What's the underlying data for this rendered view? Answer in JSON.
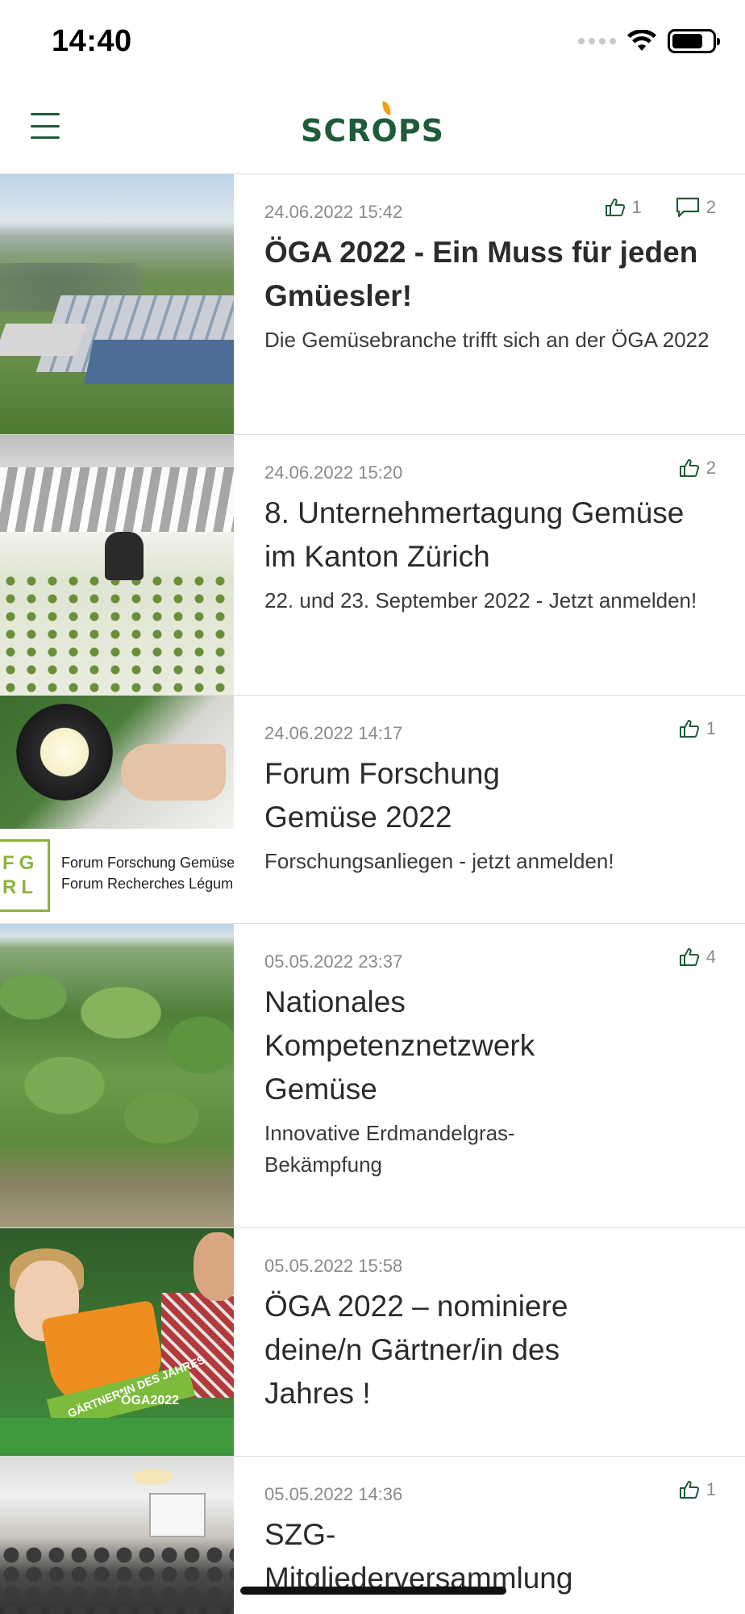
{
  "status_bar": {
    "time": "14:40"
  },
  "header": {
    "logo_text": "SCR",
    "logo_o": "O",
    "logo_end": "PS",
    "brand_color": "#1f5b3a",
    "accent_color": "#f3a012"
  },
  "articles": [
    {
      "date": "24.06.2022 15:42",
      "likes": "1",
      "comments": "2",
      "title": "ÖGA 2022 - Ein Muss für jeden Gmüesler!",
      "subtitle": "Die Gemüsebranche trifft sich an der ÖGA 2022",
      "title_bold": true
    },
    {
      "date": "24.06.2022 15:20",
      "likes": "2",
      "title": "8. Unternehmertagung Gemüse im Kanton Zürich",
      "subtitle": "22. und 23. September 2022 - Jetzt anmelden!"
    },
    {
      "date": "24.06.2022 14:17",
      "likes": "1",
      "title": "Forum Forschung Gemüse 2022",
      "subtitle": "Forschungsanliegen - jetzt anmelden!",
      "thumb_logo": "FG\nRL",
      "thumb_line1": "Forum Forschung Gemüse",
      "thumb_line2": "Forum Recherches Légum"
    },
    {
      "date": "05.05.2022 23:37",
      "likes": "4",
      "title": "Nationales Kompetenznetzwerk Gemüse",
      "subtitle": "Innovative Erdmandelgras-Bekämpfung"
    },
    {
      "date": "05.05.2022 15:58",
      "title": "ÖGA 2022 – nominiere deine/n Gärtner/in des Jahres !",
      "thumb_badge": "GÄRTNER*IN DES JAHRES",
      "thumb_event": "ÖGA2022"
    },
    {
      "date": "05.05.2022 14:36",
      "likes": "1",
      "title": "SZG-Mitgliederversammlung"
    }
  ],
  "icons": {
    "menu": "hamburger-icon",
    "like": "thumbs-up-icon",
    "comment": "comment-icon"
  }
}
